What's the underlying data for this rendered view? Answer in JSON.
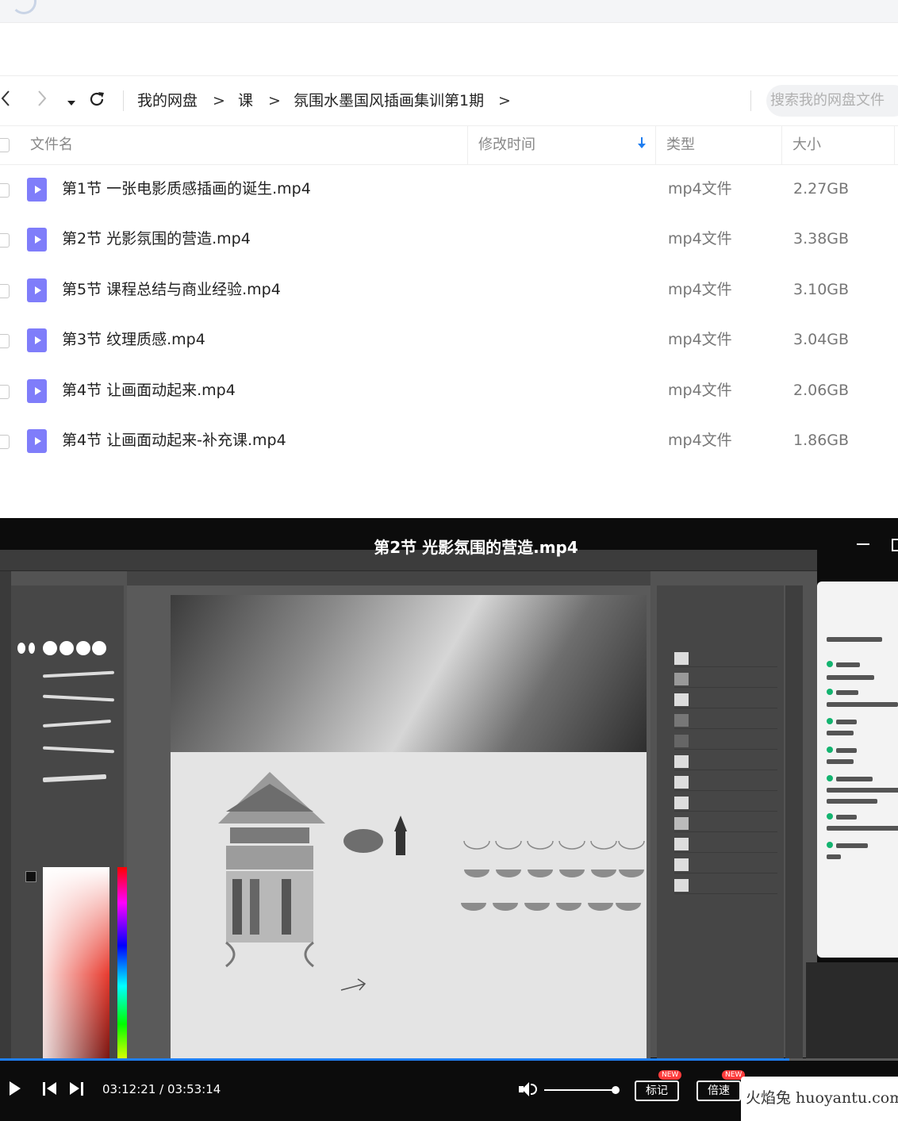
{
  "nav": {
    "back_icon": "chevron-left-icon",
    "forward_icon": "chevron-right-icon",
    "dropdown_icon": "caret-down-icon",
    "refresh_icon": "refresh-icon",
    "breadcrumbs": [
      "我的网盘",
      "课",
      "氛围水墨国风插画集训第1期"
    ],
    "separator": ">",
    "search_placeholder": "搜索我的网盘文件"
  },
  "table": {
    "headers": {
      "name": "文件名",
      "modified": "修改时间",
      "type": "类型",
      "size": "大小"
    },
    "sort_column": "modified",
    "sort_direction": "down",
    "rows": [
      {
        "name": "第1节 一张电影质感插画的诞生.mp4",
        "type": "mp4文件",
        "size": "2.27GB"
      },
      {
        "name": "第2节 光影氛围的营造.mp4",
        "type": "mp4文件",
        "size": "3.38GB"
      },
      {
        "name": "第5节 课程总结与商业经验.mp4",
        "type": "mp4文件",
        "size": "3.10GB"
      },
      {
        "name": "第3节 纹理质感.mp4",
        "type": "mp4文件",
        "size": "3.04GB"
      },
      {
        "name": "第4节 让画面动起来.mp4",
        "type": "mp4文件",
        "size": "2.06GB"
      },
      {
        "name": "第4节 让画面动起来-补充课.mp4",
        "type": "mp4文件",
        "size": "1.86GB"
      }
    ]
  },
  "player": {
    "title": "第2节 光影氛围的营造.mp4",
    "current_time": "03:12:21",
    "total_time": "03:53:14",
    "time_display": "03:12:21 / 03:53:14",
    "progress_fraction": 0.879,
    "volume_fraction": 1.0,
    "buttons": {
      "mark": "标记",
      "speed": "倍速"
    },
    "badge_new": "NEW"
  },
  "watermark": "火焰兔 huoyantu.com",
  "colors": {
    "accent": "#1f7ff5",
    "file_icon": "#7f7dfa",
    "badge": "#ff3b3b"
  }
}
